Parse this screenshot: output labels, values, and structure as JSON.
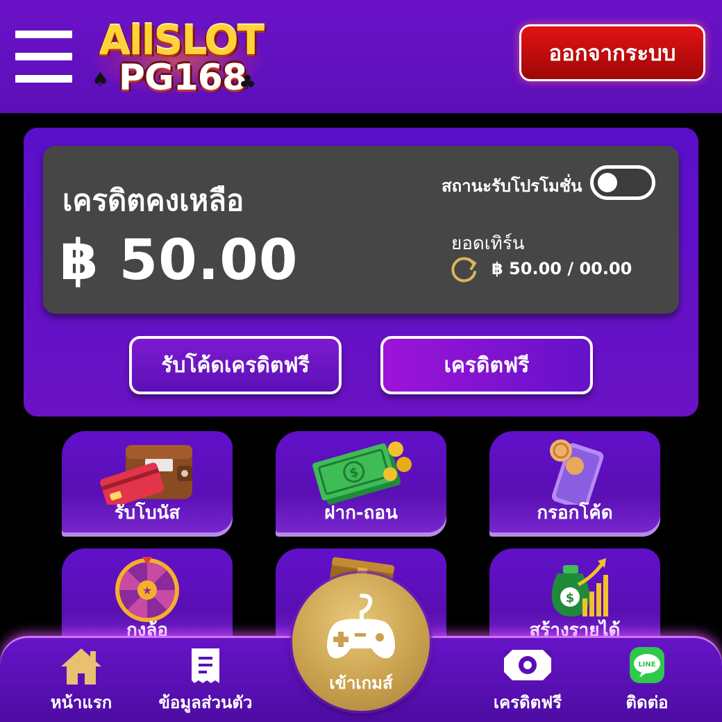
{
  "header": {
    "logo_line1": "AllSLOT",
    "logo_line2": "PG168",
    "logout_label": "ออกจากระบบ"
  },
  "credit": {
    "title": "เครดิตคงเหลือ",
    "amount": "฿ 50.00",
    "promo_status_label": "สถานะรับโปรโมชั่น",
    "promo_enabled": false,
    "turnover_label": "ยอดเทิร์น",
    "turnover_value": "฿ 50.00 / 00.00"
  },
  "actions": {
    "redeem_code_label": "รับโค้ดเครดิตฟรี",
    "free_credit_label": "เครดิตฟรี"
  },
  "tiles": [
    {
      "label": "รับโบนัส",
      "icon": "wallet-icon"
    },
    {
      "label": "ฝาก-ถอน",
      "icon": "money-icon"
    },
    {
      "label": "กรอกโค้ด",
      "icon": "phone-coin-icon"
    },
    {
      "label": "กงล้อ",
      "icon": "wheel-icon"
    },
    {
      "label": "",
      "icon": "treasure-chest-icon"
    },
    {
      "label": "สร้างรายได้",
      "icon": "money-bag-growth-icon"
    }
  ],
  "nav": {
    "home_label": "หน้าแรก",
    "profile_label": "ข้อมูลส่วนตัว",
    "game_label": "เข้าเกมส์",
    "free_credit_label": "เครดิตฟรี",
    "contact_label": "ติดต่อ"
  },
  "colors": {
    "header_bg": "#6b12c9",
    "panel_bg": "#5a0fc9",
    "card_bg": "#464646",
    "logout_red": "#d10f0f",
    "gold": "#c9a14e"
  }
}
